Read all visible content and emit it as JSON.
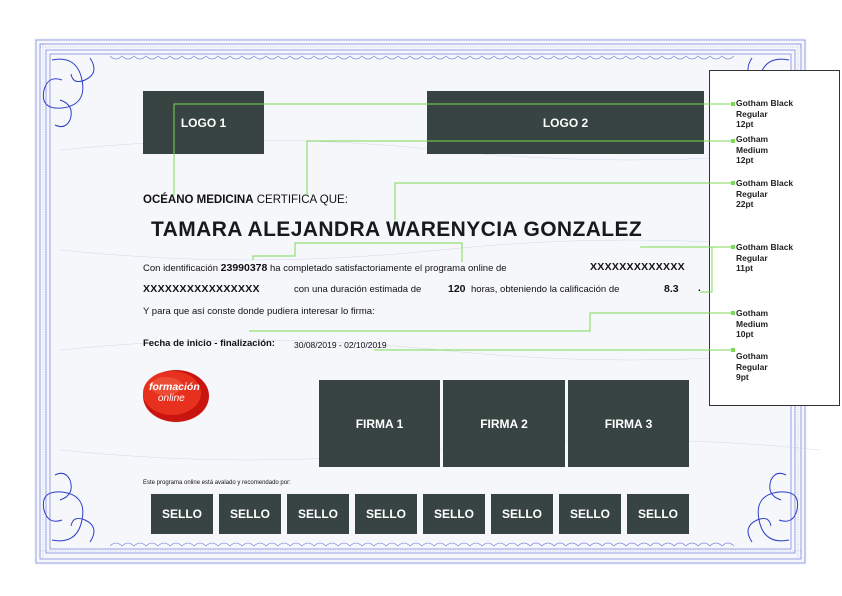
{
  "logos": {
    "logo1": "LOGO 1",
    "logo2": "LOGO 2"
  },
  "header": {
    "institution": "OCÉANO MEDICINA",
    "certifies": " CERTIFICA QUE:"
  },
  "recipient": {
    "name": "TAMARA ALEJANDRA WARENYCIA GONZALEZ"
  },
  "body": {
    "line1_prefix": "Con identificación ",
    "id_number": "23990378",
    "line1_mid": " ha completado satisfactoriamente el programa online de",
    "program_placeholder_1": "XXXXXXXXXXXXX",
    "program_placeholder_2": "XXXXXXXXXXXXXXXX",
    "line2_mid": "con una duración estimada de",
    "hours": "120",
    "line2_after_hours": "horas, obteniendo la calificación de",
    "grade": "8.3",
    "period": ".",
    "line3": "Y para que así conste donde pudiera interesar lo firma:",
    "date_label": "Fecha de inicio - finalización:",
    "date_value": "30/08/2019 - 02/10/2019"
  },
  "signatures": [
    "FIRMA 1",
    "FIRMA 2",
    "FIRMA 3"
  ],
  "endorsement": {
    "text": "Este programa online está avalado y recomendado por:"
  },
  "seals": [
    "SELLO",
    "SELLO",
    "SELLO",
    "SELLO",
    "SELLO",
    "SELLO",
    "SELLO",
    "SELLO"
  ],
  "brand": {
    "line1": "formación",
    "line2": "online"
  },
  "font_specs": [
    "Gotham Black\nRegular\n12pt",
    "Gotham\nMedium\n12pt",
    "Gotham Black\nRegular\n22pt",
    "Gotham Black\nRegular\n11pt",
    "Gotham\nMedium\n10pt",
    "Gotham\nRegular\n9pt"
  ],
  "colors": {
    "box": "#374442",
    "frame": "#3a4fd0",
    "guide": "#7ed957",
    "brand_red": "#e0261c"
  }
}
